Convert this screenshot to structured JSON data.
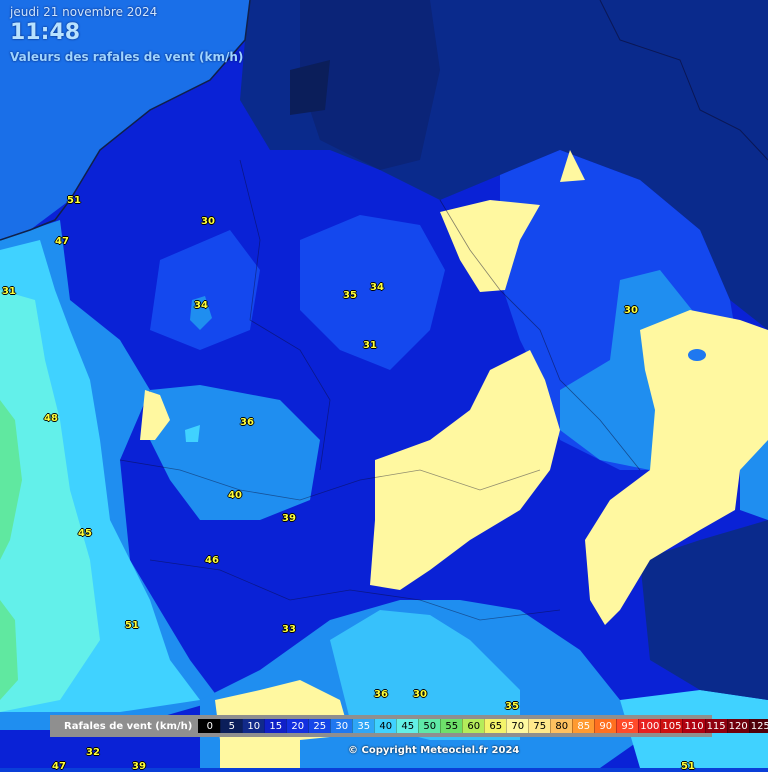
{
  "header": {
    "date": "jeudi 21 novembre 2024",
    "time": "11:48",
    "subtitle": "Valeurs des rafales de vent (km/h)"
  },
  "values": [
    "51",
    "47",
    "31",
    "30",
    "34",
    "35",
    "34",
    "31",
    "48",
    "36",
    "40",
    "39",
    "45",
    "46",
    "51",
    "33",
    "36",
    "30",
    "35",
    "32",
    "47",
    "39",
    "51",
    "30"
  ],
  "legend": {
    "title": "Rafales de vent (km/h)",
    "steps": [
      {
        "label": "0",
        "bg": "#000000",
        "fg": "#ffffff"
      },
      {
        "label": "5",
        "bg": "#0b1e5a",
        "fg": "#ffffff"
      },
      {
        "label": "10",
        "bg": "#112a8a",
        "fg": "#ffffff"
      },
      {
        "label": "15",
        "bg": "#1020c8",
        "fg": "#ffffff"
      },
      {
        "label": "20",
        "bg": "#1330e0",
        "fg": "#ffffff"
      },
      {
        "label": "25",
        "bg": "#1646e8",
        "fg": "#ffffff"
      },
      {
        "label": "30",
        "bg": "#1f78f0",
        "fg": "#ffffff"
      },
      {
        "label": "35",
        "bg": "#2fa6f6",
        "fg": "#ffffff"
      },
      {
        "label": "40",
        "bg": "#40d2ff",
        "fg": "#000000"
      },
      {
        "label": "45",
        "bg": "#63f0e6",
        "fg": "#000000"
      },
      {
        "label": "50",
        "bg": "#5fe8a8",
        "fg": "#000000"
      },
      {
        "label": "55",
        "bg": "#6ee06a",
        "fg": "#000000"
      },
      {
        "label": "60",
        "bg": "#b4ec5a",
        "fg": "#000000"
      },
      {
        "label": "65",
        "bg": "#f4f46a",
        "fg": "#000000"
      },
      {
        "label": "70",
        "bg": "#fff8a0",
        "fg": "#000000"
      },
      {
        "label": "75",
        "bg": "#ffe88c",
        "fg": "#000000"
      },
      {
        "label": "80",
        "bg": "#ffc060",
        "fg": "#000000"
      },
      {
        "label": "85",
        "bg": "#ff9a30",
        "fg": "#ffffff"
      },
      {
        "label": "90",
        "bg": "#ff7020",
        "fg": "#ffffff"
      },
      {
        "label": "95",
        "bg": "#ff4a2a",
        "fg": "#ffffff"
      },
      {
        "label": "100",
        "bg": "#e82020",
        "fg": "#ffffff"
      },
      {
        "label": "105",
        "bg": "#cc1010",
        "fg": "#ffffff"
      },
      {
        "label": "110",
        "bg": "#b00010",
        "fg": "#ffffff"
      },
      {
        "label": "115",
        "bg": "#900010",
        "fg": "#ffffff"
      },
      {
        "label": "120",
        "bg": "#70000c",
        "fg": "#ffffff"
      },
      {
        "label": "125",
        "bg": "#50000a",
        "fg": "#ffffff"
      }
    ]
  },
  "copyright": "© Copyright Meteociel.fr 2024",
  "colors": {
    "sea": "#1a6fe8",
    "dark": "#0a2a8c",
    "deep": "#0a1fd8",
    "mid": "#1448ee",
    "light": "#1f8ef0",
    "cyan": "#40d2ff",
    "aqua": "#63f0ea",
    "green": "#60e8a0",
    "yellow": "#fff8a0"
  }
}
